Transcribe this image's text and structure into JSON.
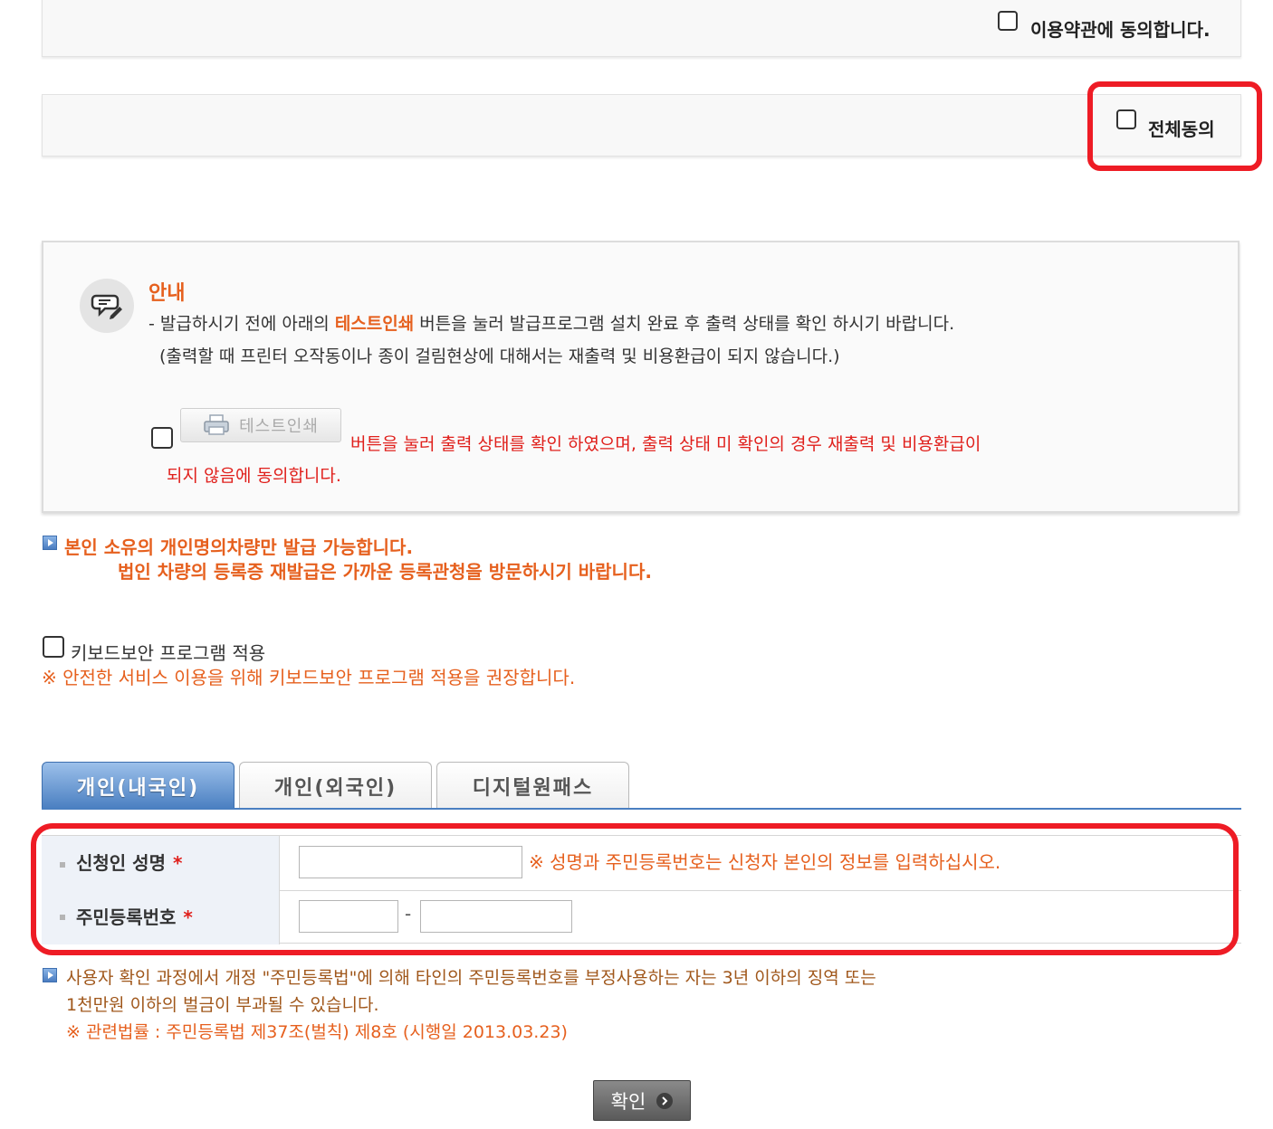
{
  "terms": {
    "agree_label": "이용약관에 동의합니다."
  },
  "all_agree": {
    "label": "전체동의"
  },
  "notice": {
    "title": "안내",
    "line1_prefix": "- 발급하시기 전에 아래의 ",
    "line1_highlight": "테스트인쇄",
    "line1_suffix": " 버튼을 눌러 발급프로그램 설치 완료 후 출력 상태를 확인 하시기 바랍니다.",
    "line2": "(출력할 때 프린터 오작동이나 종이 걸림현상에 대해서는 재출력 및 비용환급이 되지 않습니다.)",
    "test_print_button": "테스트인쇄",
    "confirm_text_line1": "버튼을 눌러 출력 상태를 확인 하였으며, 출력 상태 미 확인의 경우 재출력 및 비용환급이",
    "confirm_text_line2": "되지 않음에 동의합니다."
  },
  "ownership_notice": {
    "line1": "본인 소유의 개인명의차량만 발급 가능합니다.",
    "line2": "법인 차량의 등록증 재발급은 가까운 등록관청을 방문하시기 바랍니다."
  },
  "keyboard_security": {
    "label": "키보드보안 프로그램 적용",
    "recommendation": "※ 안전한 서비스 이용을 위해 키보드보안 프로그램 적용을 권장합니다."
  },
  "tabs": [
    {
      "label": "개인(내국인)",
      "active": true
    },
    {
      "label": "개인(외국인)",
      "active": false
    },
    {
      "label": "디지털원패스",
      "active": false
    }
  ],
  "form": {
    "name_label": "신청인 성명",
    "name_value": "",
    "name_hint": "※ 성명과 주민등록번호는 신청자 본인의 정보를 입력하십시오.",
    "rrn_label": "주민등록번호",
    "rrn_front_value": "",
    "rrn_back_value": "",
    "rrn_separator": "-",
    "required_mark": "*"
  },
  "legal_notice": {
    "line1": "사용자 확인 과정에서 개정 \"주민등록법\"에 의해 타인의 주민등록번호를 부정사용하는 자는 3년 이하의 징역 또는",
    "line2": "1천만원 이하의 벌금이 부과될 수 있습니다.",
    "line3": "※ 관련법률 : 주민등록법 제37조(벌칙) 제8호 (시행일 2013.03.23)"
  },
  "confirm_button": {
    "label": "확인"
  },
  "colors": {
    "highlight_red": "#ee1c25",
    "accent_orange": "#e6601e",
    "tab_blue": "#4a7fc1"
  }
}
